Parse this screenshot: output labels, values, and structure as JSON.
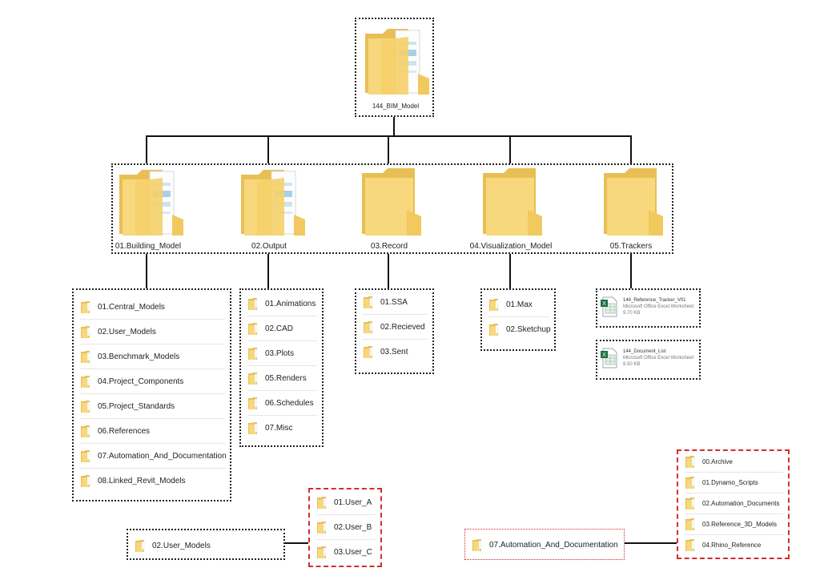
{
  "root": {
    "label": "144_BIM_Model",
    "icon": "folder-with-documents-icon"
  },
  "level1": [
    {
      "label": "01.Building_Model",
      "icon": "folder-with-documents-icon"
    },
    {
      "label": "02.Output",
      "icon": "folder-with-documents-icon"
    },
    {
      "label": "03.Record",
      "icon": "folder-icon"
    },
    {
      "label": "04.Visualization_Model",
      "icon": "folder-icon"
    },
    {
      "label": "05.Trackers",
      "icon": "folder-icon"
    }
  ],
  "building_model_items": [
    "01.Central_Models",
    "02.User_Models",
    "03.Benchmark_Models",
    "04.Project_Components",
    "05.Project_Standards",
    "06.References",
    "07.Automation_And_Documentation",
    "08.Linked_Revit_Models"
  ],
  "output_items": [
    "01.Animations",
    "02.CAD",
    "03.Plots",
    "05.Renders",
    "06.Schedules",
    "07.Misc"
  ],
  "record_items": [
    "01.SSA",
    "02.Recieved",
    "03.Sent"
  ],
  "visualization_items": [
    "01.Max",
    "02.Sketchup"
  ],
  "trackers": [
    {
      "name": "144_Reference_Tracker_V01",
      "type": "Microsoft Office Excel Worksheet",
      "size": "9.70 KB",
      "icon": "excel-file-icon"
    },
    {
      "name": "144_Document_List",
      "type": "Microsoft Office Excel Worksheet",
      "size": "8.50 KB",
      "icon": "excel-file-icon"
    }
  ],
  "user_models": {
    "label": "02.User_Models",
    "items": [
      "01.User_A",
      "02.User_B",
      "03.User_C"
    ]
  },
  "automation": {
    "label": "07.Automation_And_Documentation",
    "items": [
      "00.Archive",
      "01.Dynamo_Scripts",
      "02.Automation_Documents",
      "03.Reference_3D_Models",
      "04.Rhino_Reference"
    ]
  },
  "colors": {
    "folder": "#f7d87c",
    "folder_dark": "#e8bf55",
    "red": "#d62b2b",
    "line": "#111111"
  }
}
